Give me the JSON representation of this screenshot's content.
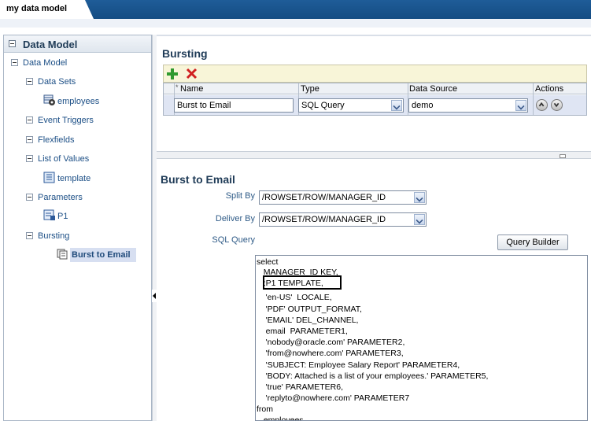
{
  "tab": {
    "title": "my data model"
  },
  "left": {
    "header": "Data Model",
    "tree": {
      "root": "Data Model",
      "data_sets": "Data Sets",
      "employees": "employees",
      "event_triggers": "Event Triggers",
      "flexfields": "Flexfields",
      "lov": "List of Values",
      "template": "template",
      "parameters": "Parameters",
      "p1": "P1",
      "bursting": "Bursting",
      "burst_to_email": "Burst to Email"
    }
  },
  "bursting": {
    "title": "Bursting",
    "columns": {
      "name": "Name",
      "type": "Type",
      "data_source": "Data Source",
      "actions": "Actions"
    },
    "row": {
      "name": "Burst to Email",
      "type": "SQL Query",
      "data_source": "demo"
    }
  },
  "detail": {
    "title": "Burst to Email",
    "split_by_label": "Split By",
    "split_by_value": "/ROWSET/ROW/MANAGER_ID",
    "deliver_by_label": "Deliver By",
    "deliver_by_value": "/ROWSET/ROW/MANAGER_ID",
    "sql_query_label": "SQL Query",
    "query_builder": "Query Builder",
    "sql_lines": [
      "select",
      "   MANAGER_ID KEY,",
      "   :P1 TEMPLATE,",
      "    'en-US'  LOCALE,",
      "    'PDF' OUTPUT_FORMAT,",
      "    'EMAIL' DEL_CHANNEL,",
      "    email  PARAMETER1,",
      "    'nobody@oracle.com' PARAMETER2,",
      "    'from@nowhere.com' PARAMETER3,",
      "    'SUBJECT: Employee Salary Report' PARAMETER4,",
      "    'BODY: Attached is a list of your employees.' PARAMETER5,",
      "    'true' PARAMETER6,",
      "    'replyto@nowhere.com' PARAMETER7",
      "from",
      "   employees"
    ]
  },
  "colors": {
    "topbar": "#1f5c98",
    "link": "#1c4f86",
    "heading": "#1f3b57",
    "toolbar": "#f8f5d8"
  }
}
